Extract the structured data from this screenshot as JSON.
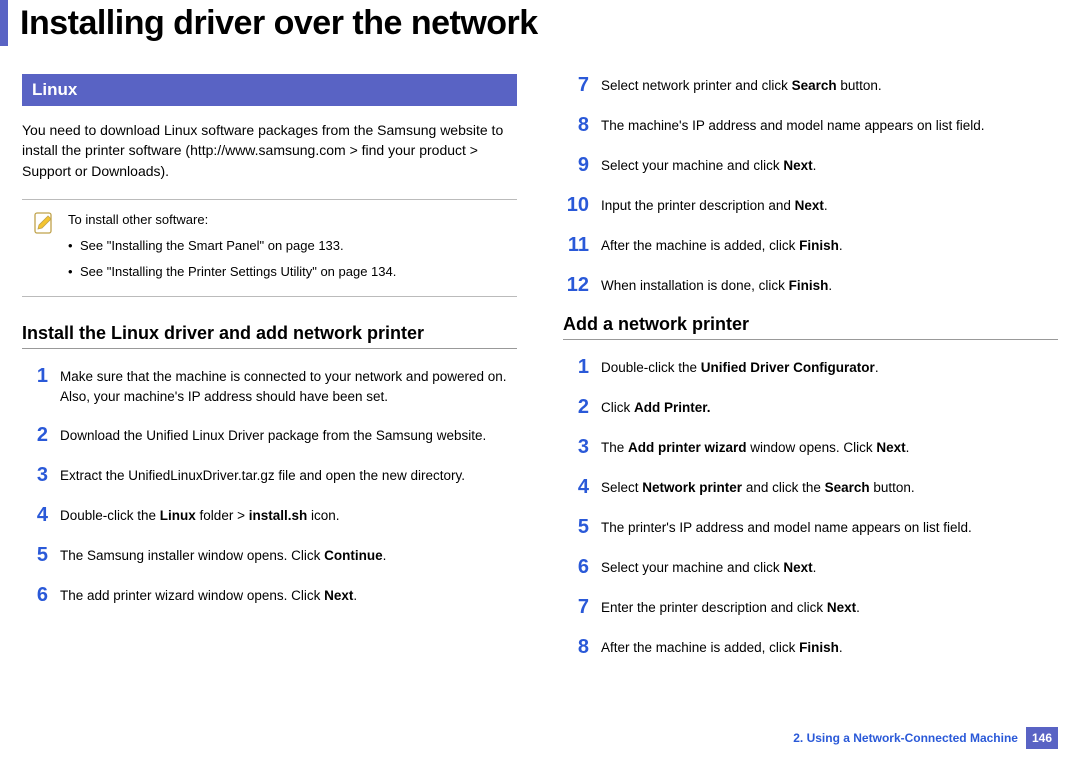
{
  "title": "Installing driver over the network",
  "section_label": "Linux",
  "intro": "You need to download Linux software packages from the Samsung website to install the printer software (http://www.samsung.com > find your product > Support or Downloads).",
  "note": {
    "lead": "To install other software:",
    "items": [
      "See \"Installing the Smart Panel\" on page 133.",
      "See \"Installing the Printer Settings Utility\" on page 134."
    ]
  },
  "sub1": {
    "heading": "Install the Linux driver and add network printer",
    "steps": [
      "Make sure that the machine is connected to your network and powered on. Also, your machine's IP address should have been set.",
      "Download the Unified Linux Driver package from the Samsung website.",
      "Extract the UnifiedLinuxDriver.tar.gz file and open the new directory.",
      "Double-click the <b>Linux</b> folder > <b>install.sh</b> icon.",
      "The Samsung installer window opens. Click <b>Continue</b>.",
      "The add printer wizard window opens. Click <b>Next</b>."
    ]
  },
  "sub1_cont": {
    "start": 7,
    "steps": [
      "Select network printer and click <b>Search</b> button.",
      "The machine's IP address and model name appears on list field.",
      "Select your machine and click <b>Next</b>.",
      "Input the printer description and <b>Next</b>.",
      "After the machine is added, click <b>Finish</b>.",
      "When installation is done, click <b>Finish</b>."
    ]
  },
  "sub2": {
    "heading": "Add a network printer",
    "steps": [
      "Double-click the <b>Unified Driver Configurator</b>.",
      "Click <b>Add Printer.</b>",
      "The <b>Add printer wizard</b> window opens. Click <b>Next</b>.",
      "Select <b>Network printer</b> and click the <b>Search</b> button.",
      "The printer's IP address and model name appears on list field.",
      "Select your machine and click <b>Next</b>.",
      "Enter the printer description and click <b>Next</b>.",
      "After the machine is added, click <b>Finish</b>."
    ]
  },
  "footer": {
    "chapter": "2.  Using a Network-Connected Machine",
    "page": "146"
  }
}
